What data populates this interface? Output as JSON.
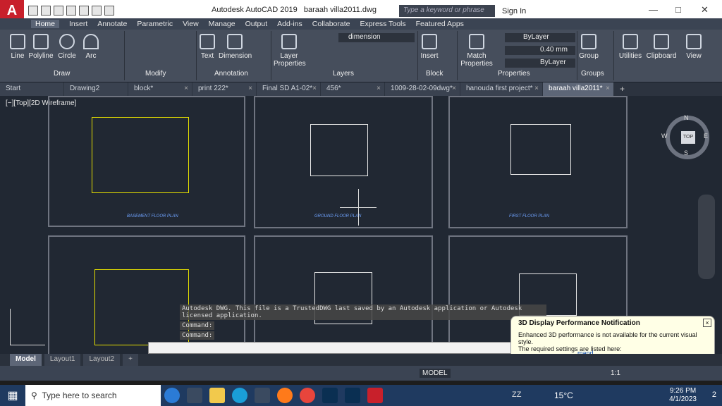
{
  "title_bar": {
    "app_title": "Autodesk AutoCAD 2019",
    "file_title": "baraah villa2011.dwg",
    "search_placeholder": "Type a keyword or phrase",
    "signin_label": "Sign In"
  },
  "menu": {
    "items": [
      "Home",
      "Insert",
      "Annotate",
      "Parametric",
      "View",
      "Manage",
      "Output",
      "Add-ins",
      "Collaborate",
      "Express Tools",
      "Featured Apps"
    ],
    "active": "Home"
  },
  "ribbon": {
    "draw": {
      "tools": [
        "Line",
        "Polyline",
        "Circle",
        "Arc"
      ],
      "group_label": "Draw"
    },
    "modify": {
      "group_label": "Modify"
    },
    "annotation": {
      "tools": [
        "Text",
        "Dimension"
      ],
      "group_label": "Annotation"
    },
    "layers": {
      "layer_name": "dimension",
      "tool": "Layer Properties",
      "group_label": "Layers"
    },
    "block": {
      "tool": "Insert",
      "group_label": "Block"
    },
    "properties": {
      "tool": "Match Properties",
      "color": "ByLayer",
      "lineweight": "0.40 mm",
      "linetype": "ByLayer",
      "group_label": "Properties"
    },
    "groups": {
      "tool": "Group",
      "group_label": "Groups"
    },
    "extra": [
      "Utilities",
      "Clipboard",
      "View"
    ]
  },
  "file_tabs": [
    "Start",
    "Drawing2",
    "block*",
    "print 222*",
    "Final SD A1-02*",
    "456*",
    "1009-28-02-09dwg*",
    "hanouda first project*",
    "baraah villa2011*"
  ],
  "active_file_tab": "baraah villa2011*",
  "viewport": {
    "label": "[−][Top][2D Wireframe]",
    "captions": [
      "BASEMENT FLOOR PLAN",
      "GROUND FLOOR PLAN",
      "FIRST FLOOR PLAN"
    ],
    "viewcube": {
      "top": "TOP",
      "n": "N",
      "w": "W",
      "e": "E",
      "s": "S"
    }
  },
  "command": {
    "history": "Autodesk DWG.  This file is a TrustedDWG last saved by an Autodesk application or Autodesk licensed application.",
    "line1": "Command:",
    "line2": "Command:"
  },
  "notification": {
    "title": "3D Display Performance Notification",
    "body": "Enhanced 3D performance is not available for the current visual style.",
    "body2": "The required settings are listed here:",
    "link": "mand"
  },
  "layout_tabs": [
    "Model",
    "Layout1",
    "Layout2"
  ],
  "status": {
    "model": "MODEL",
    "scale": "1:1"
  },
  "taskbar": {
    "search": "Type here to search",
    "weather": "15°C",
    "time": "9:26 PM",
    "date": "4/1/2023",
    "zz": "ZZ",
    "notif_count": "2"
  },
  "colors": {
    "accent": "#c8202b",
    "ribbon": "#464e5c",
    "viewport": "#212833"
  }
}
